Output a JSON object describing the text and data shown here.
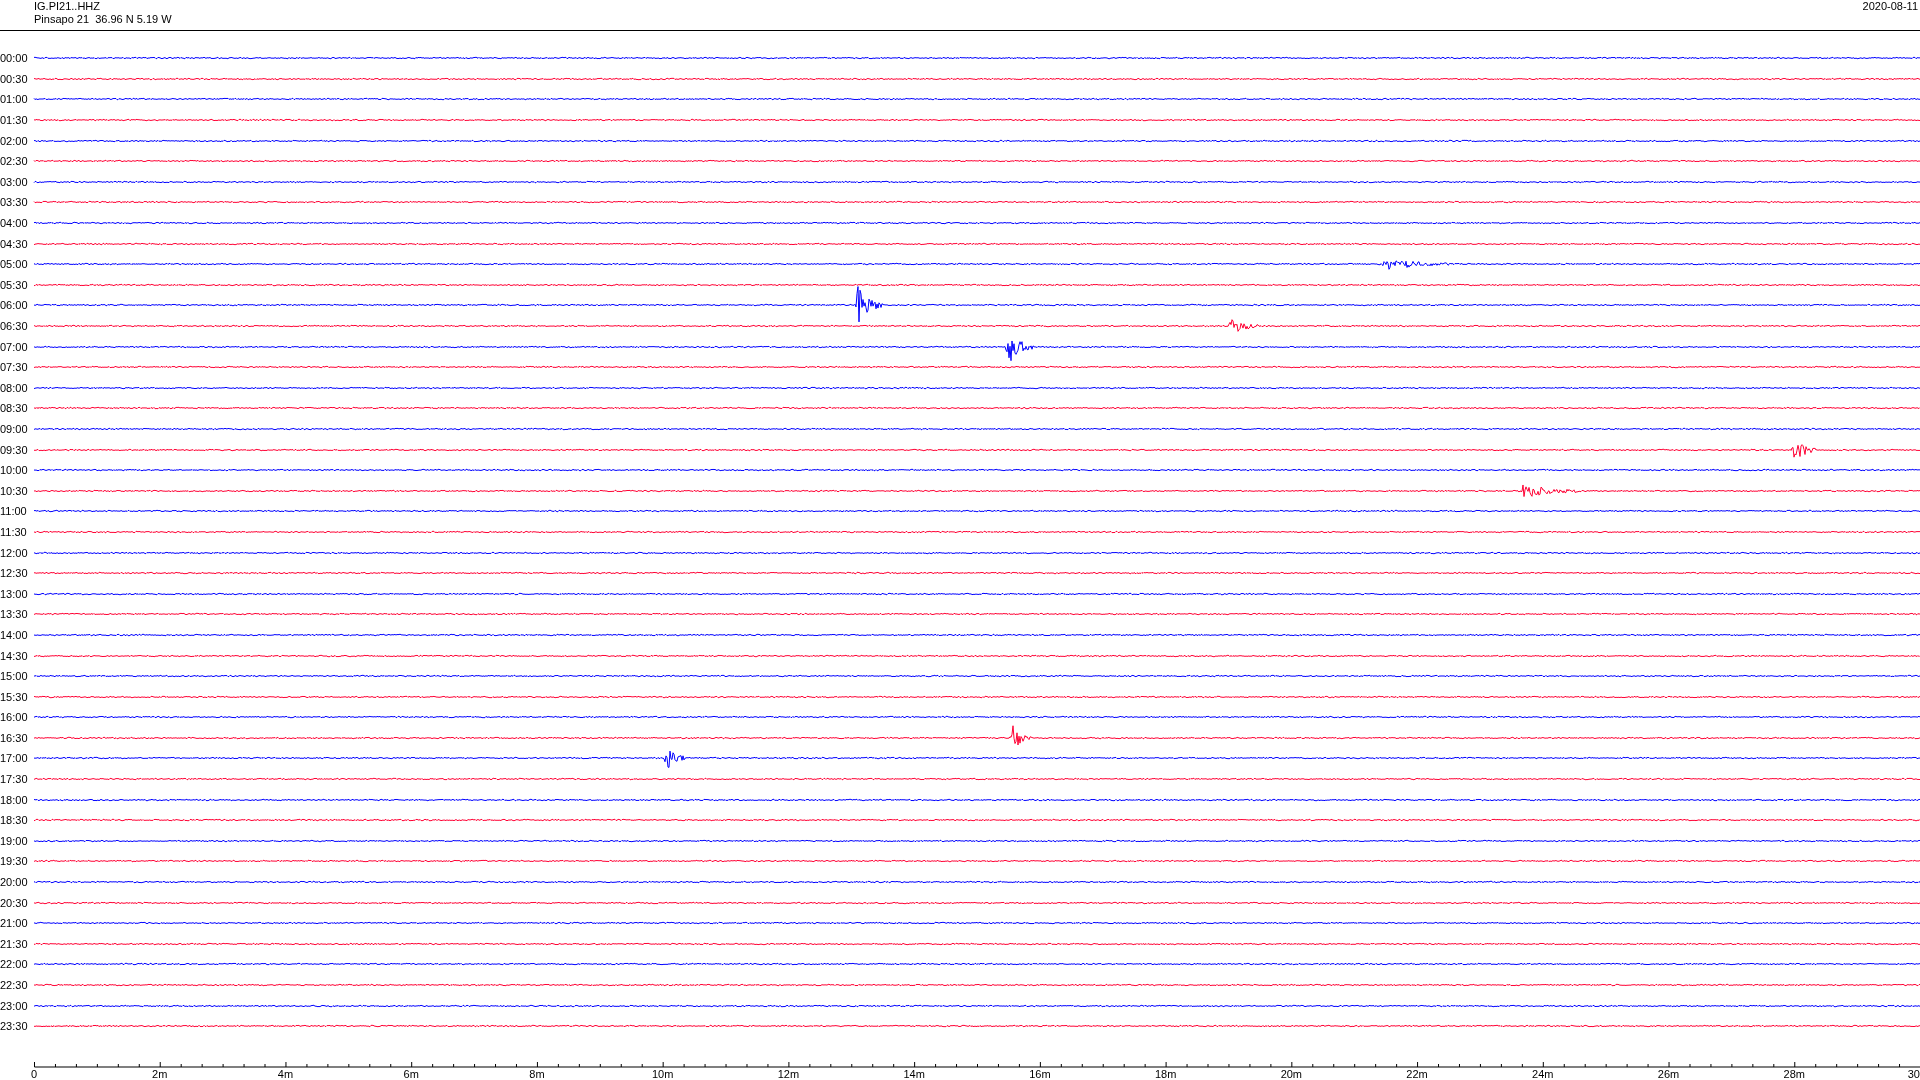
{
  "header": {
    "title": "IG.PI21..HHZ",
    "subtitle": "Pinsapo 21  36.96 N 5.19 W",
    "date": "2020-08-11"
  },
  "rows": [
    {
      "label": "00:00",
      "color": "#0000ff"
    },
    {
      "label": "00:30",
      "color": "#ff0033"
    },
    {
      "label": "01:00",
      "color": "#0000ff"
    },
    {
      "label": "01:30",
      "color": "#ff0033"
    },
    {
      "label": "02:00",
      "color": "#0000ff"
    },
    {
      "label": "02:30",
      "color": "#ff0033"
    },
    {
      "label": "03:00",
      "color": "#0000ff"
    },
    {
      "label": "03:30",
      "color": "#ff0033"
    },
    {
      "label": "04:00",
      "color": "#0000ff"
    },
    {
      "label": "04:30",
      "color": "#ff0033"
    },
    {
      "label": "05:00",
      "color": "#0000ff"
    },
    {
      "label": "05:30",
      "color": "#ff0033"
    },
    {
      "label": "06:00",
      "color": "#0000ff"
    },
    {
      "label": "06:30",
      "color": "#ff0033"
    },
    {
      "label": "07:00",
      "color": "#0000ff"
    },
    {
      "label": "07:30",
      "color": "#ff0033"
    },
    {
      "label": "08:00",
      "color": "#0000ff"
    },
    {
      "label": "08:30",
      "color": "#ff0033"
    },
    {
      "label": "09:00",
      "color": "#0000ff"
    },
    {
      "label": "09:30",
      "color": "#ff0033"
    },
    {
      "label": "10:00",
      "color": "#0000ff"
    },
    {
      "label": "10:30",
      "color": "#ff0033"
    },
    {
      "label": "11:00",
      "color": "#0000ff"
    },
    {
      "label": "11:30",
      "color": "#ff0033"
    },
    {
      "label": "12:00",
      "color": "#0000ff"
    },
    {
      "label": "12:30",
      "color": "#ff0033"
    },
    {
      "label": "13:00",
      "color": "#0000ff"
    },
    {
      "label": "13:30",
      "color": "#ff0033"
    },
    {
      "label": "14:00",
      "color": "#0000ff"
    },
    {
      "label": "14:30",
      "color": "#ff0033"
    },
    {
      "label": "15:00",
      "color": "#0000ff"
    },
    {
      "label": "15:30",
      "color": "#ff0033"
    },
    {
      "label": "16:00",
      "color": "#0000ff"
    },
    {
      "label": "16:30",
      "color": "#ff0033"
    },
    {
      "label": "17:00",
      "color": "#0000ff"
    },
    {
      "label": "17:30",
      "color": "#ff0033"
    },
    {
      "label": "18:00",
      "color": "#0000ff"
    },
    {
      "label": "18:30",
      "color": "#ff0033"
    },
    {
      "label": "19:00",
      "color": "#0000ff"
    },
    {
      "label": "19:30",
      "color": "#ff0033"
    },
    {
      "label": "20:00",
      "color": "#0000ff"
    },
    {
      "label": "20:30",
      "color": "#ff0033"
    },
    {
      "label": "21:00",
      "color": "#0000ff"
    },
    {
      "label": "21:30",
      "color": "#ff0033"
    },
    {
      "label": "22:00",
      "color": "#0000ff"
    },
    {
      "label": "22:30",
      "color": "#ff0033"
    },
    {
      "label": "23:00",
      "color": "#0000ff"
    },
    {
      "label": "23:30",
      "color": "#ff0033"
    }
  ],
  "axis": {
    "labels": [
      "0",
      "2m",
      "4m",
      "6m",
      "8m",
      "10m",
      "12m",
      "14m",
      "16m",
      "18m",
      "20m",
      "22m",
      "24m",
      "26m",
      "28m",
      "30"
    ]
  }
}
